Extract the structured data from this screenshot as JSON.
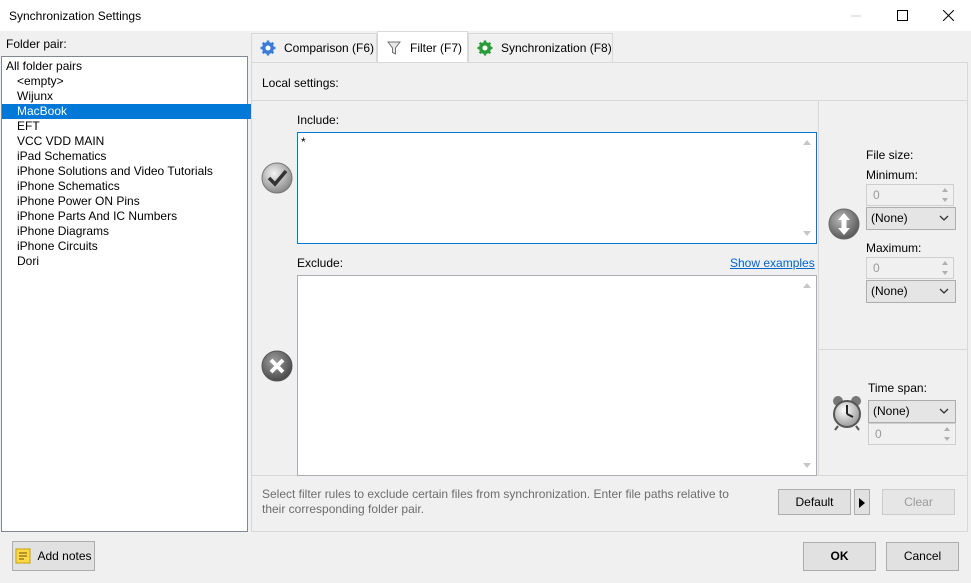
{
  "window": {
    "title": "Synchronization Settings"
  },
  "left": {
    "label": "Folder pair:",
    "items": [
      "All folder pairs",
      "<empty>",
      "Wijunx",
      "MacBook",
      "EFT",
      "VCC VDD MAIN",
      "iPad Schematics",
      "iPhone Solutions and Video Tutorials",
      "iPhone Schematics",
      "iPhone Power ON Pins",
      "iPhone Parts And IC Numbers",
      "iPhone Diagrams",
      "iPhone Circuits",
      "Dori"
    ],
    "selected": "MacBook"
  },
  "tabs": [
    {
      "label": "Comparison (F6)",
      "icon": "gear-blue-icon"
    },
    {
      "label": "Filter (F7)",
      "icon": "funnel-icon",
      "active": true
    },
    {
      "label": "Synchronization (F8)",
      "icon": "gear-green-icon"
    }
  ],
  "filter": {
    "local_settings": "Local settings:",
    "include_label": "Include:",
    "include_value": "*",
    "exclude_label": "Exclude:",
    "exclude_value": "",
    "show_examples": "Show examples",
    "hint": "Select filter rules to exclude certain files from synchronization. Enter file paths relative to their corresponding folder pair.",
    "file_size": "File size:",
    "minimum_label": "Minimum:",
    "minimum_value": "0",
    "minimum_unit": "(None)",
    "maximum_label": "Maximum:",
    "maximum_value": "0",
    "maximum_unit": "(None)",
    "time_span_label": "Time span:",
    "time_span_value": "(None)",
    "time_span_number": "0",
    "default_button": "Default",
    "clear_button": "Clear"
  },
  "footer": {
    "add_notes": "Add notes",
    "ok": "OK",
    "cancel": "Cancel"
  }
}
